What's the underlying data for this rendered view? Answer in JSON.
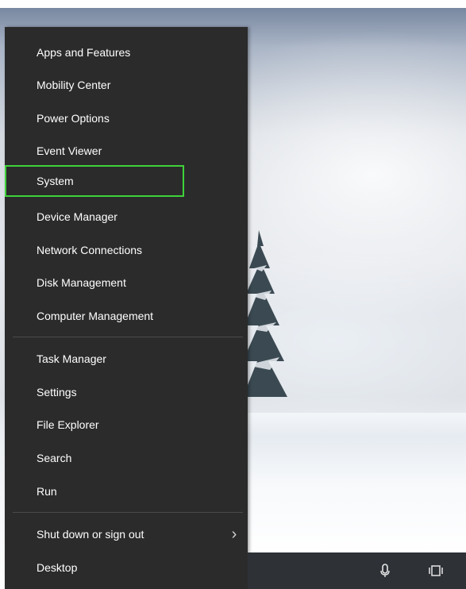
{
  "menu": {
    "items": [
      {
        "label": "Apps and Features"
      },
      {
        "label": "Mobility Center"
      },
      {
        "label": "Power Options"
      },
      {
        "label": "Event Viewer"
      },
      {
        "label": "System",
        "highlighted": true
      },
      {
        "label": "Device Manager"
      },
      {
        "label": "Network Connections"
      },
      {
        "label": "Disk Management"
      },
      {
        "label": "Computer Management"
      },
      {
        "label": "Task Manager"
      },
      {
        "label": "Settings"
      },
      {
        "label": "File Explorer"
      },
      {
        "label": "Search"
      },
      {
        "label": "Run"
      },
      {
        "label": "Shut down or sign out",
        "has_submenu": true
      },
      {
        "label": "Desktop"
      }
    ]
  },
  "taskbar": {
    "icons": [
      "microphone-icon",
      "task-view-icon"
    ]
  },
  "colors": {
    "menu_bg": "#2b2b2b",
    "highlight_border": "#3fd23a",
    "text": "#ffffff"
  }
}
